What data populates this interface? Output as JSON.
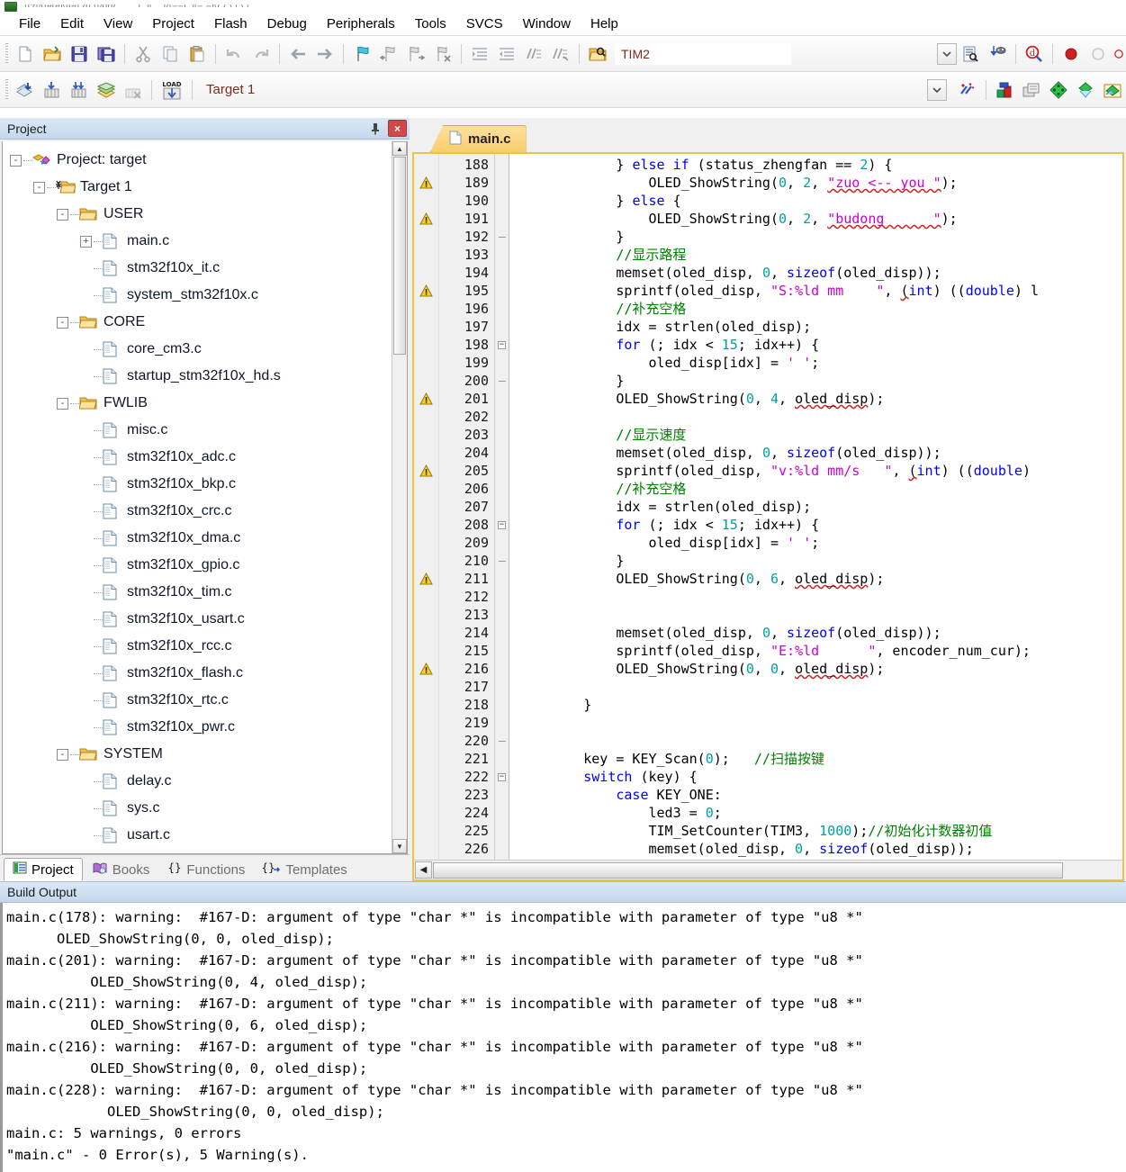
{
  "window": {
    "title_fragment": "[]7]/[]#[#]\\[[#] ([]  []/[][]( ___ [_][__]([==]_][=  =]\\(    (   )   |   )   |"
  },
  "menubar": {
    "items": [
      "File",
      "Edit",
      "View",
      "Project",
      "Flash",
      "Debug",
      "Peripherals",
      "Tools",
      "SVCS",
      "Window",
      "Help"
    ]
  },
  "toolbar1": {
    "buttons": [
      {
        "name": "new-file-icon",
        "title": "New"
      },
      {
        "name": "open-file-icon",
        "title": "Open"
      },
      {
        "name": "save-icon",
        "title": "Save"
      },
      {
        "name": "save-all-icon",
        "title": "Save All"
      },
      {
        "name": "cut-icon",
        "title": "Cut"
      },
      {
        "name": "copy-icon",
        "title": "Copy"
      },
      {
        "name": "paste-icon",
        "title": "Paste"
      },
      {
        "name": "undo-icon",
        "title": "Undo"
      },
      {
        "name": "redo-icon",
        "title": "Redo"
      },
      {
        "name": "back-arrow-icon",
        "title": "Back"
      },
      {
        "name": "forward-arrow-icon",
        "title": "Forward"
      },
      {
        "name": "bookmark-toggle-icon",
        "title": "Insert/Remove Bookmark"
      },
      {
        "name": "bookmark-prev-icon",
        "title": "Previous Bookmark"
      },
      {
        "name": "bookmark-next-icon",
        "title": "Next Bookmark"
      },
      {
        "name": "bookmark-clear-icon",
        "title": "Clear All Bookmarks"
      },
      {
        "name": "indent-icon",
        "title": "Indent"
      },
      {
        "name": "outdent-icon",
        "title": "Outdent"
      },
      {
        "name": "comment-icon",
        "title": "Comment"
      },
      {
        "name": "uncomment-icon",
        "title": "Uncomment"
      },
      {
        "name": "find-in-files-icon",
        "title": "Find in Files"
      }
    ],
    "search_value": "TIM2",
    "right_buttons": [
      {
        "name": "chevron-down-icon",
        "title": "Dropdown"
      },
      {
        "name": "source-browse-icon",
        "title": "Source Browse"
      },
      {
        "name": "configure-icon",
        "title": "Configure"
      },
      {
        "name": "debug-magnifier-icon",
        "title": "Start/Stop Debug Session"
      },
      {
        "name": "breakpoint-red-icon",
        "title": "Insert/Remove Breakpoint"
      },
      {
        "name": "breakpoint-disable-icon",
        "title": "Disable Breakpoint"
      },
      {
        "name": "breakpoint-disable-all-icon",
        "title": "Disable All Breakpoints"
      }
    ]
  },
  "toolbar2": {
    "buttons": [
      {
        "name": "translate-icon",
        "title": "Translate"
      },
      {
        "name": "build-icon",
        "title": "Build"
      },
      {
        "name": "rebuild-icon",
        "title": "Rebuild"
      },
      {
        "name": "batch-build-icon",
        "title": "Batch Build"
      },
      {
        "name": "stop-build-icon",
        "title": "Stop Build"
      },
      {
        "name": "load-icon",
        "title": "Download"
      }
    ],
    "target_label": "Target 1",
    "right_buttons": [
      {
        "name": "target-options-icon",
        "title": "Options for Target"
      },
      {
        "name": "manage-components-icon",
        "title": "Manage Project Items"
      },
      {
        "name": "pack-installer-icon",
        "title": "Pack Installer"
      },
      {
        "name": "manage-rte-icon",
        "title": "Manage Run-Time Environment"
      },
      {
        "name": "select-software-packs-icon",
        "title": "Select Software Packs"
      }
    ]
  },
  "project_pane": {
    "title": "Project",
    "pin_glyph": "ツ",
    "close_glyph": "×",
    "tree": [
      {
        "label": "Project: target",
        "depth": 0,
        "expander": "-",
        "icon": "project-icon"
      },
      {
        "label": "Target 1",
        "depth": 1,
        "expander": "-",
        "icon": "target-icon"
      },
      {
        "label": "USER",
        "depth": 2,
        "expander": "-",
        "icon": "folder-icon"
      },
      {
        "label": "main.c",
        "depth": 3,
        "expander": "+",
        "icon": "file-icon"
      },
      {
        "label": "stm32f10x_it.c",
        "depth": 3,
        "expander": "",
        "icon": "file-icon"
      },
      {
        "label": "system_stm32f10x.c",
        "depth": 3,
        "expander": "",
        "icon": "file-icon"
      },
      {
        "label": "CORE",
        "depth": 2,
        "expander": "-",
        "icon": "folder-icon"
      },
      {
        "label": "core_cm3.c",
        "depth": 3,
        "expander": "",
        "icon": "file-icon"
      },
      {
        "label": "startup_stm32f10x_hd.s",
        "depth": 3,
        "expander": "",
        "icon": "file-icon"
      },
      {
        "label": "FWLIB",
        "depth": 2,
        "expander": "-",
        "icon": "folder-icon"
      },
      {
        "label": "misc.c",
        "depth": 3,
        "expander": "",
        "icon": "file-icon"
      },
      {
        "label": "stm32f10x_adc.c",
        "depth": 3,
        "expander": "",
        "icon": "file-icon"
      },
      {
        "label": "stm32f10x_bkp.c",
        "depth": 3,
        "expander": "",
        "icon": "file-icon"
      },
      {
        "label": "stm32f10x_crc.c",
        "depth": 3,
        "expander": "",
        "icon": "file-icon"
      },
      {
        "label": "stm32f10x_dma.c",
        "depth": 3,
        "expander": "",
        "icon": "file-icon"
      },
      {
        "label": "stm32f10x_gpio.c",
        "depth": 3,
        "expander": "",
        "icon": "file-icon"
      },
      {
        "label": "stm32f10x_tim.c",
        "depth": 3,
        "expander": "",
        "icon": "file-icon"
      },
      {
        "label": "stm32f10x_usart.c",
        "depth": 3,
        "expander": "",
        "icon": "file-icon"
      },
      {
        "label": "stm32f10x_rcc.c",
        "depth": 3,
        "expander": "",
        "icon": "file-icon"
      },
      {
        "label": "stm32f10x_flash.c",
        "depth": 3,
        "expander": "",
        "icon": "file-icon"
      },
      {
        "label": "stm32f10x_rtc.c",
        "depth": 3,
        "expander": "",
        "icon": "file-icon"
      },
      {
        "label": "stm32f10x_pwr.c",
        "depth": 3,
        "expander": "",
        "icon": "file-icon"
      },
      {
        "label": "SYSTEM",
        "depth": 2,
        "expander": "-",
        "icon": "folder-icon"
      },
      {
        "label": "delay.c",
        "depth": 3,
        "expander": "",
        "icon": "file-icon"
      },
      {
        "label": "sys.c",
        "depth": 3,
        "expander": "",
        "icon": "file-icon"
      },
      {
        "label": "usart.c",
        "depth": 3,
        "expander": "",
        "icon": "file-icon"
      }
    ],
    "tabs": [
      {
        "label": "Project",
        "icon": "project-tab-icon",
        "active": true
      },
      {
        "label": "Books",
        "icon": "books-tab-icon",
        "active": false
      },
      {
        "label": "Functions",
        "icon": "functions-tab-icon",
        "active": false
      },
      {
        "label": "Templates",
        "icon": "templates-tab-icon",
        "active": false
      }
    ]
  },
  "editor": {
    "tab_label": "main.c",
    "first_line": 188,
    "lines": [
      {
        "n": 188,
        "warn": false,
        "fold": "",
        "html": "            } <span class=\"kw\">else</span> <span class=\"kw\">if</span> (status_zhengfan == <span class=\"num\">2</span>) {"
      },
      {
        "n": 189,
        "warn": true,
        "fold": "",
        "html": "                OLED_ShowString(<span class=\"num\">0</span>, <span class=\"num\">2</span>, <span class=\"str wavy\">\"zuo &lt;-- you \"</span>);"
      },
      {
        "n": 190,
        "warn": false,
        "fold": "",
        "html": "            } <span class=\"kw\">else</span> {"
      },
      {
        "n": 191,
        "warn": true,
        "fold": "",
        "html": "                OLED_ShowString(<span class=\"num\">0</span>, <span class=\"num\">2</span>, <span class=\"str wavy\">\"budong      \"</span>);"
      },
      {
        "n": 192,
        "warn": false,
        "fold": "end",
        "html": "            }"
      },
      {
        "n": 193,
        "warn": false,
        "fold": "",
        "html": "            <span class=\"cmt\">//显示路程</span>"
      },
      {
        "n": 194,
        "warn": false,
        "fold": "",
        "html": "            memset(oled_disp, <span class=\"num\">0</span>, <span class=\"kw\">sizeof</span>(oled_disp));"
      },
      {
        "n": 195,
        "warn": true,
        "fold": "",
        "html": "            sprintf(oled_disp, <span class=\"str\">\"S:%ld mm    \"</span>, <span class=\"wavy\">(</span><span class=\"kw\">int</span>) ((<span class=\"kw\">double</span>) l"
      },
      {
        "n": 196,
        "warn": false,
        "fold": "",
        "html": "            <span class=\"cmt\">//补充空格</span>"
      },
      {
        "n": 197,
        "warn": false,
        "fold": "",
        "html": "            idx = strlen(oled_disp);"
      },
      {
        "n": 198,
        "warn": false,
        "fold": "start",
        "html": "            <span class=\"kw\">for</span> (; idx &lt; <span class=\"num\">15</span>; idx++) {"
      },
      {
        "n": 199,
        "warn": false,
        "fold": "",
        "html": "                oled_disp[idx] = <span class=\"str\">' '</span>;"
      },
      {
        "n": 200,
        "warn": false,
        "fold": "end",
        "html": "            }"
      },
      {
        "n": 201,
        "warn": true,
        "fold": "",
        "html": "            OLED_ShowString(<span class=\"num\">0</span>, <span class=\"num\">4</span>, <span class=\"wavy\">oled_disp</span>);"
      },
      {
        "n": 202,
        "warn": false,
        "fold": "",
        "html": ""
      },
      {
        "n": 203,
        "warn": false,
        "fold": "",
        "html": "            <span class=\"cmt\">//显示速度</span>"
      },
      {
        "n": 204,
        "warn": false,
        "fold": "",
        "html": "            memset(oled_disp, <span class=\"num\">0</span>, <span class=\"kw\">sizeof</span>(oled_disp));"
      },
      {
        "n": 205,
        "warn": true,
        "fold": "",
        "html": "            sprintf(oled_disp, <span class=\"str\">\"v:%ld mm/s   \"</span>, <span class=\"wavy\">(</span><span class=\"kw\">int</span>) ((<span class=\"kw\">double</span>)"
      },
      {
        "n": 206,
        "warn": false,
        "fold": "",
        "html": "            <span class=\"cmt\">//补充空格</span>"
      },
      {
        "n": 207,
        "warn": false,
        "fold": "",
        "html": "            idx = strlen(oled_disp);"
      },
      {
        "n": 208,
        "warn": false,
        "fold": "start",
        "html": "            <span class=\"kw\">for</span> (; idx &lt; <span class=\"num\">15</span>; idx++) {"
      },
      {
        "n": 209,
        "warn": false,
        "fold": "",
        "html": "                oled_disp[idx] = <span class=\"str\">' '</span>;"
      },
      {
        "n": 210,
        "warn": false,
        "fold": "end",
        "html": "            }"
      },
      {
        "n": 211,
        "warn": true,
        "fold": "",
        "html": "            OLED_ShowString(<span class=\"num\">0</span>, <span class=\"num\">6</span>, <span class=\"wavy\">oled_disp</span>);"
      },
      {
        "n": 212,
        "warn": false,
        "fold": "",
        "html": ""
      },
      {
        "n": 213,
        "warn": false,
        "fold": "",
        "html": ""
      },
      {
        "n": 214,
        "warn": false,
        "fold": "",
        "html": "            memset(oled_disp, <span class=\"num\">0</span>, <span class=\"kw\">sizeof</span>(oled_disp));"
      },
      {
        "n": 215,
        "warn": false,
        "fold": "",
        "html": "            sprintf(oled_disp, <span class=\"str\">\"E:%ld      \"</span>, encoder_num_cur);"
      },
      {
        "n": 216,
        "warn": true,
        "fold": "",
        "html": "            OLED_ShowString(<span class=\"num\">0</span>, <span class=\"num\">0</span>, <span class=\"wavy\">oled_disp</span>);"
      },
      {
        "n": 217,
        "warn": false,
        "fold": "",
        "html": ""
      },
      {
        "n": 218,
        "warn": false,
        "fold": "",
        "html": "        }"
      },
      {
        "n": 219,
        "warn": false,
        "fold": "",
        "html": ""
      },
      {
        "n": 220,
        "warn": false,
        "fold": "end",
        "html": ""
      },
      {
        "n": 221,
        "warn": false,
        "fold": "",
        "html": "        key = KEY_Scan(<span class=\"num\">0</span>);   <span class=\"cmt\">//扫描按键</span>"
      },
      {
        "n": 222,
        "warn": false,
        "fold": "start",
        "html": "        <span class=\"kw\">switch</span> (key) {"
      },
      {
        "n": 223,
        "warn": false,
        "fold": "",
        "html": "            <span class=\"kw\">case</span> KEY_ONE:"
      },
      {
        "n": 224,
        "warn": false,
        "fold": "",
        "html": "                led3 = <span class=\"num\">0</span>;"
      },
      {
        "n": 225,
        "warn": false,
        "fold": "",
        "html": "                TIM_SetCounter(TIM3, <span class=\"num\">1000</span>);<span class=\"cmt\">//初始化计数器初值</span>"
      },
      {
        "n": 226,
        "warn": false,
        "fold": "",
        "html": "                memset(oled_disp, <span class=\"num\">0</span>, <span class=\"kw\">sizeof</span>(oled_disp));"
      }
    ]
  },
  "build_output": {
    "title": "Build Output",
    "lines": [
      "main.c(178): warning:  #167-D: argument of type \"char *\" is incompatible with parameter of type \"u8 *\"",
      "      OLED_ShowString(0, 0, oled_disp);",
      "main.c(201): warning:  #167-D: argument of type \"char *\" is incompatible with parameter of type \"u8 *\"",
      "          OLED_ShowString(0, 4, oled_disp);",
      "main.c(211): warning:  #167-D: argument of type \"char *\" is incompatible with parameter of type \"u8 *\"",
      "          OLED_ShowString(0, 6, oled_disp);",
      "main.c(216): warning:  #167-D: argument of type \"char *\" is incompatible with parameter of type \"u8 *\"",
      "          OLED_ShowString(0, 0, oled_disp);",
      "main.c(228): warning:  #167-D: argument of type \"char *\" is incompatible with parameter of type \"u8 *\"",
      "            OLED_ShowString(0, 0, oled_disp);",
      "main.c: 5 warnings, 0 errors",
      "\"main.c\" - 0 Error(s), 5 Warning(s)."
    ]
  },
  "colors": {
    "tab_accent": "#f0c04a",
    "pane_header": "#c5d8ec",
    "keyword": "#0000ff",
    "string": "#cc00cc",
    "comment": "#008000",
    "number": "#00a0a0",
    "warning": "#f2c012"
  }
}
